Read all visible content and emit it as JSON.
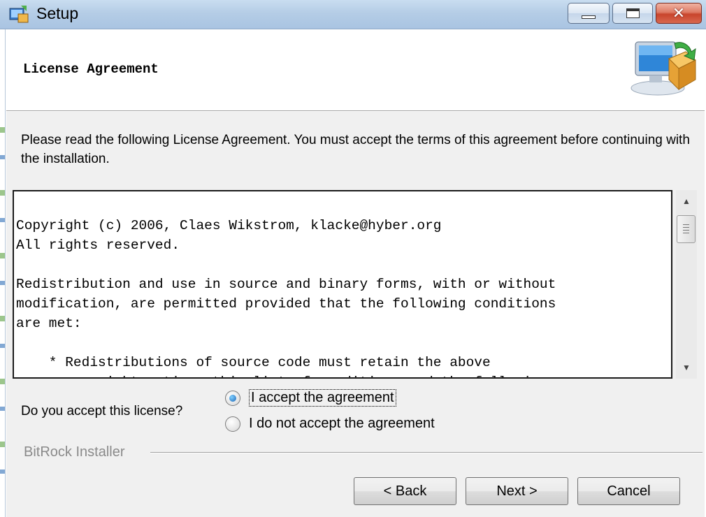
{
  "window": {
    "title": "Setup",
    "close_glyph": "✕",
    "app_icon": "setup-installer-icon"
  },
  "header": {
    "title": "License Agreement",
    "icon": "computer-install-icon"
  },
  "intro_text": "Please read the following License Agreement. You must accept the terms of this agreement before continuing with the installation.",
  "license": {
    "text": "Copyright (c) 2006, Claes Wikstrom, klacke@hyber.org\nAll rights reserved.\n\nRedistribution and use in source and binary forms, with or without\nmodification, are permitted provided that the following conditions\nare met:\n\n    * Redistributions of source code must retain the above\n      copyright notice, this list of conditions and the following"
  },
  "scrollbar": {
    "up_glyph": "▲",
    "down_glyph": "▼"
  },
  "accept": {
    "question": "Do you accept this license?",
    "options": [
      {
        "label": "I accept the agreement",
        "checked": true
      },
      {
        "label": "I do not accept the agreement",
        "checked": false
      }
    ]
  },
  "footer": {
    "brand": "BitRock Installer"
  },
  "buttons": {
    "back": "< Back",
    "next": "Next >",
    "cancel": "Cancel"
  },
  "colors": {
    "titlebar": "#b5cde6",
    "body_bg": "#f0f0f0",
    "close_button": "#c8442c"
  }
}
